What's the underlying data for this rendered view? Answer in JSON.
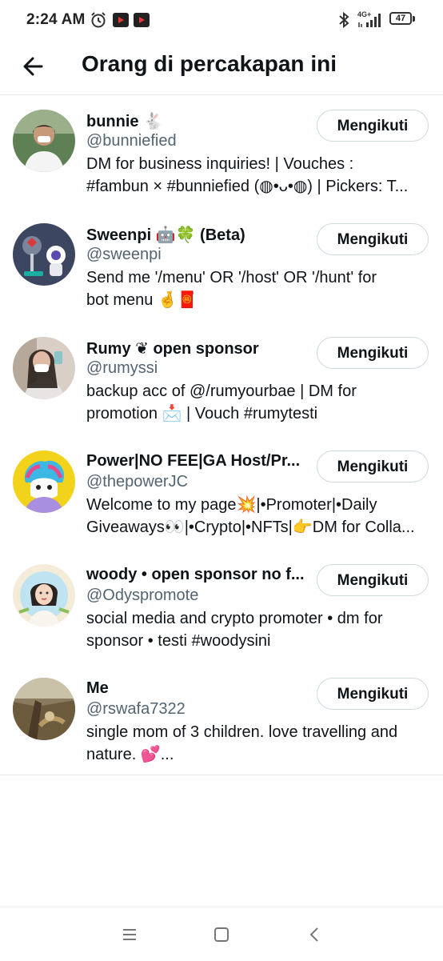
{
  "status_bar": {
    "time": "2:24 AM",
    "network": "4G+",
    "battery": "47"
  },
  "header": {
    "title": "Orang di percakapan ini"
  },
  "follow_label": "Mengikuti",
  "users": [
    {
      "name": "bunnie 🐇",
      "handle": "@bunniefied",
      "bio": [
        "DM for business inquiries! | Vouches :",
        "#fambun × #bunniefied (◍•ᴗ•◍) | Pickers: T..."
      ]
    },
    {
      "name": "Sweenpi 🤖🍀 (Beta)",
      "handle": "@sweenpi",
      "bio": [
        "Send me '/menu' OR '/host' OR '/hunt' for",
        "bot menu 🤞🧧"
      ]
    },
    {
      "name": "Rumy ❦ open sponsor",
      "handle": "@rumyssi",
      "bio": [
        "backup acc of @/rumyourbae | DM for",
        "promotion 📩 | Vouch #rumytesti"
      ]
    },
    {
      "name": "Power|NO FEE|GA Host/Pr...",
      "handle": "@thepowerJC",
      "bio": [
        "Welcome to my page💥|•Promoter|•Daily",
        "Giveaways👀|•Crypto|•NFTs|👉DM for Colla..."
      ]
    },
    {
      "name": "woody • open sponsor no f...",
      "handle": "@Odyspromote",
      "bio": [
        "social media and crypto promoter • dm for",
        "sponsor • testi #woodysini"
      ]
    },
    {
      "name": "Me",
      "handle": "@rswafa7322",
      "bio": [
        "single mom of 3 children. love travelling and",
        "nature. 💕..."
      ]
    }
  ],
  "icons": {
    "back": "arrow-left-icon",
    "status": [
      "alarm-icon",
      "youtube-icon",
      "bluetooth-icon",
      "signal-icon",
      "battery-icon"
    ],
    "nav": [
      "menu-icon",
      "home-square-icon",
      "back-chevron-icon"
    ]
  },
  "colors": {
    "text": "#0f1419",
    "secondary": "#536471",
    "border": "#cfd9de"
  }
}
